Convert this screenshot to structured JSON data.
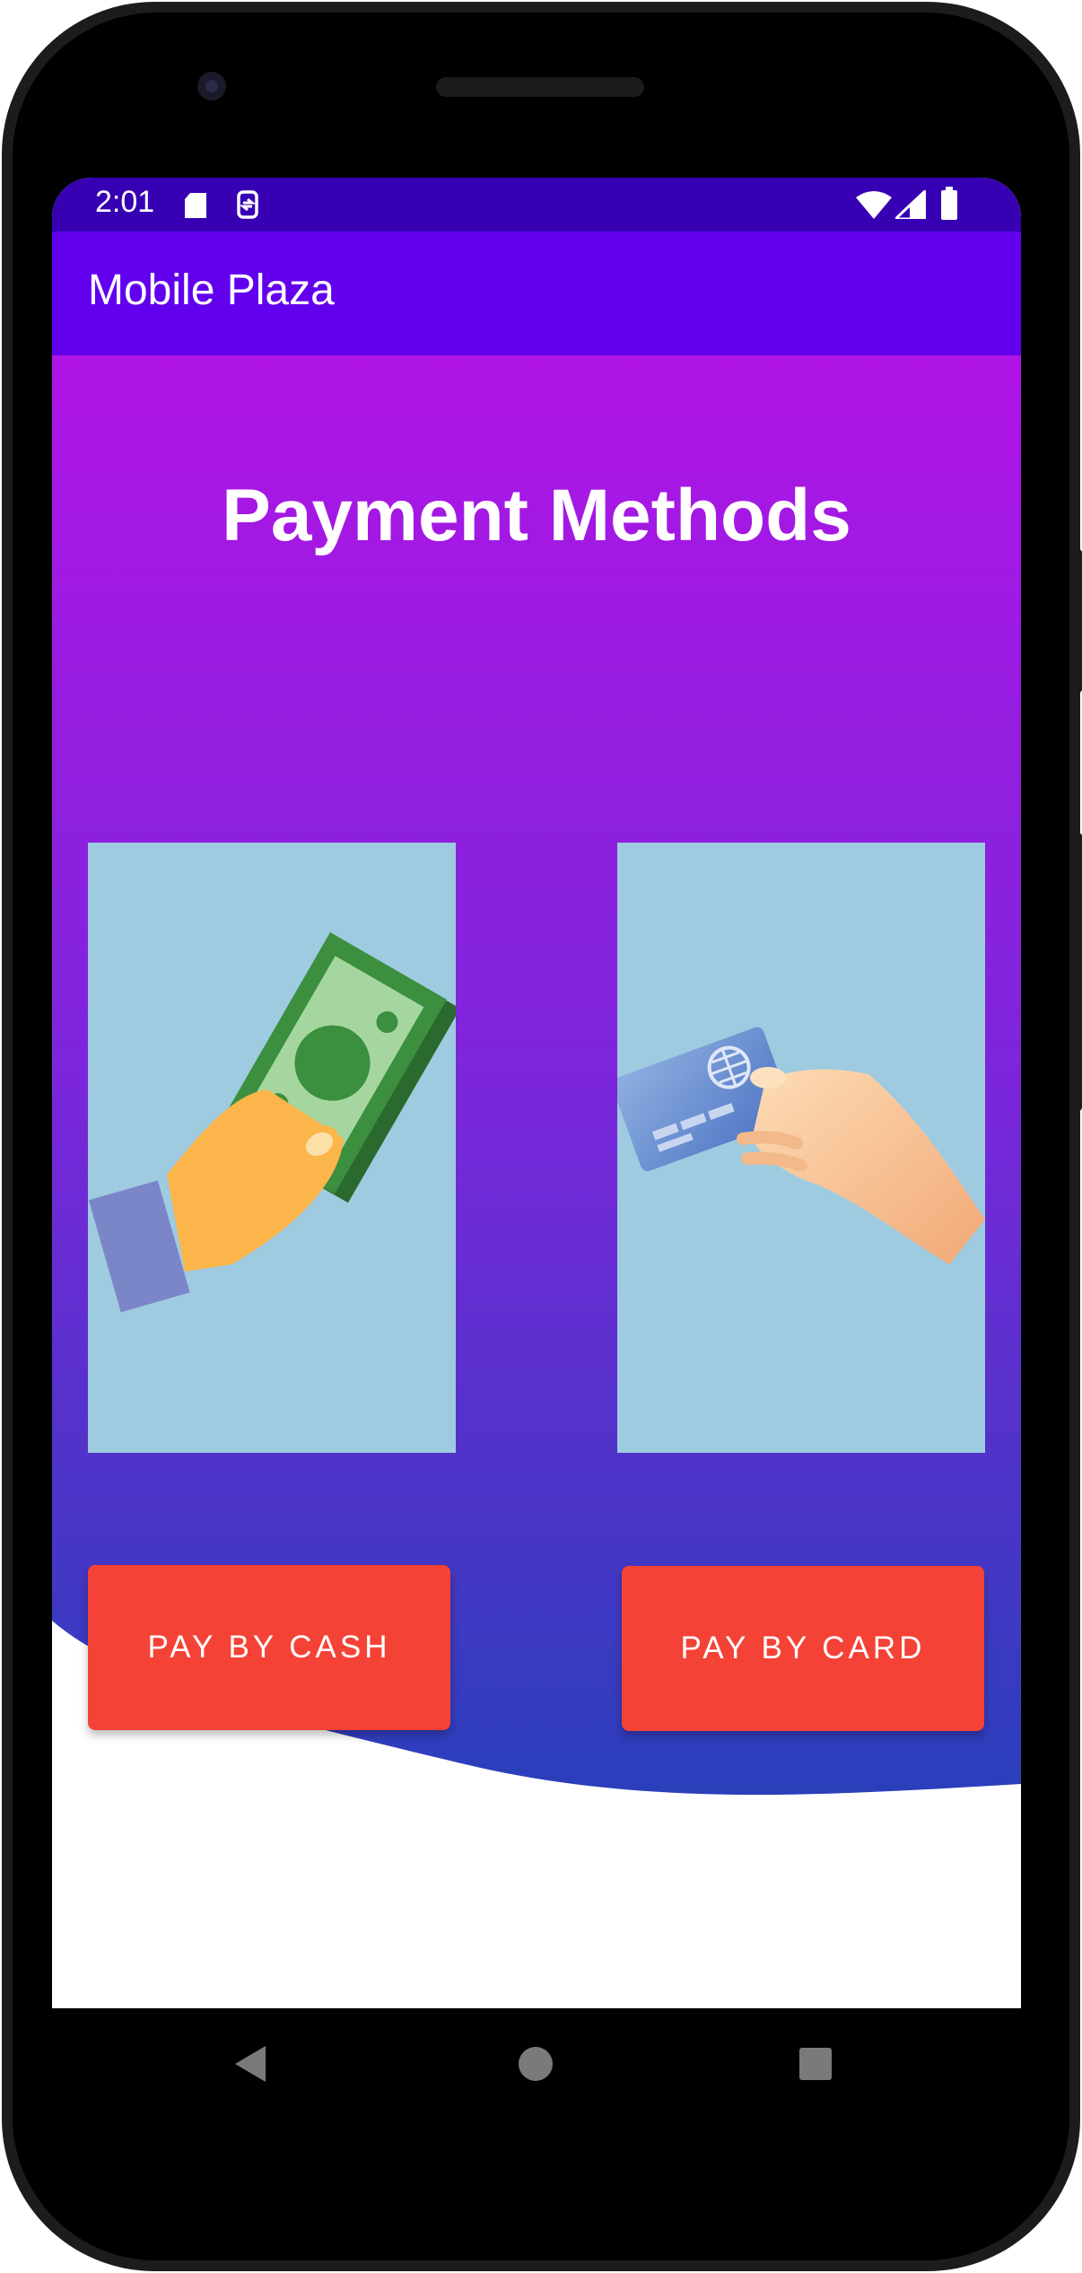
{
  "status_bar": {
    "time": "2:01",
    "icons": [
      "sd-card-icon",
      "app-notification-icon",
      "wifi-icon",
      "cell-signal-icon",
      "battery-icon"
    ]
  },
  "app_bar": {
    "title": "Mobile Plaza"
  },
  "main": {
    "title": "Payment Methods",
    "options": [
      {
        "image": "hand-cash-icon",
        "button_label": "PAY BY CASH"
      },
      {
        "image": "hand-card-icon",
        "button_label": "PAY BY CARD"
      }
    ]
  },
  "nav_bar": {
    "buttons": [
      "back-icon",
      "home-icon",
      "recents-icon"
    ]
  },
  "colors": {
    "status_bar": "#3700b3",
    "app_bar": "#6200ee",
    "gradient_top": "#b014e6",
    "gradient_bottom": "#2a3fba",
    "button": "#f44336",
    "image_bg": "#9fcbe0"
  }
}
